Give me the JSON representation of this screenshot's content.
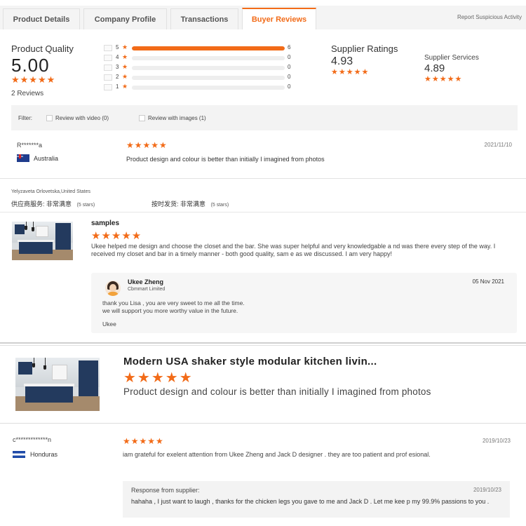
{
  "tabs": [
    {
      "label": "Product Details"
    },
    {
      "label": "Company Profile"
    },
    {
      "label": "Transactions"
    },
    {
      "label": "Buyer Reviews"
    }
  ],
  "report_link": "Report Suspicious Activity",
  "summary": {
    "product_quality": {
      "title": "Product Quality",
      "score": "5.00",
      "stars": "★★★★★",
      "reviews": "2 Reviews"
    },
    "distribution": [
      {
        "label": "5",
        "star": "★",
        "count": "6",
        "fill": 1.0
      },
      {
        "label": "4",
        "star": "★",
        "count": "0",
        "fill": 0
      },
      {
        "label": "3",
        "star": "★",
        "count": "0",
        "fill": 0
      },
      {
        "label": "2",
        "star": "★",
        "count": "0",
        "fill": 0
      },
      {
        "label": "1",
        "star": "★",
        "count": "0",
        "fill": 0
      }
    ],
    "supplier_ratings": {
      "title": "Supplier Ratings",
      "score": "4.93",
      "stars": "★★★★★"
    },
    "supplier_services": {
      "title": "Supplier Services",
      "score": "4.89",
      "stars": "★★★★★"
    }
  },
  "filter": {
    "label": "Filter:",
    "video": "Review with video (0)",
    "images": "Review with images (1)"
  },
  "review1": {
    "name": "R*******a",
    "country": "Australia",
    "stars": "★★★★★",
    "date": "2021/11/10",
    "text": "Product design and colour is better than initially I imagined from photos"
  },
  "translated": {
    "user": "Yelyzaveta Orlovetska,United States",
    "service_label": "供应商服务: 非常满意",
    "service_stars": "(5 stars)",
    "delivery_label": "按时发货: 非常满意",
    "delivery_stars": "(5 stars)"
  },
  "review2": {
    "title": "samples",
    "stars": "★★★★★",
    "text": "Ukee helped me design and choose the closet and the bar. She was super helpful and very knowledgable a nd was there every step of the way. I received my closet and bar in a timely manner - both good quality, sam e as we discussed. I am very happy!",
    "reply": {
      "name": "Ukee Zheng",
      "company": "Cbmmart Limited",
      "date": "05 Nov 2021",
      "line1": "thank you Lisa ,  you are  very sweet to me all the time.",
      "line2": "we will support you more worthy value in the future.",
      "sign": "Ukee"
    }
  },
  "featured": {
    "title": "Modern USA shaker style modular kitchen livin...",
    "stars": "★★★★★",
    "text": "Product design and colour is better than initially I imagined from photos"
  },
  "review3": {
    "name": "c*************n",
    "country": "Honduras",
    "stars": "★★★★★",
    "date": "2019/10/23",
    "text": "iam grateful for exelent attention from Ukee Zheng and Jack D designer . they are too patient and prof esional.",
    "response_label": "Response from supplier:",
    "response_date": "2019/10/23",
    "response_text": "hahaha , I just want to laugh , thanks for the chicken legs you gave to me and Jack D . Let me kee p my 99.9% passions to you ."
  },
  "colors": {
    "accent": "#f26b18",
    "cabinet": "#233a5e"
  }
}
